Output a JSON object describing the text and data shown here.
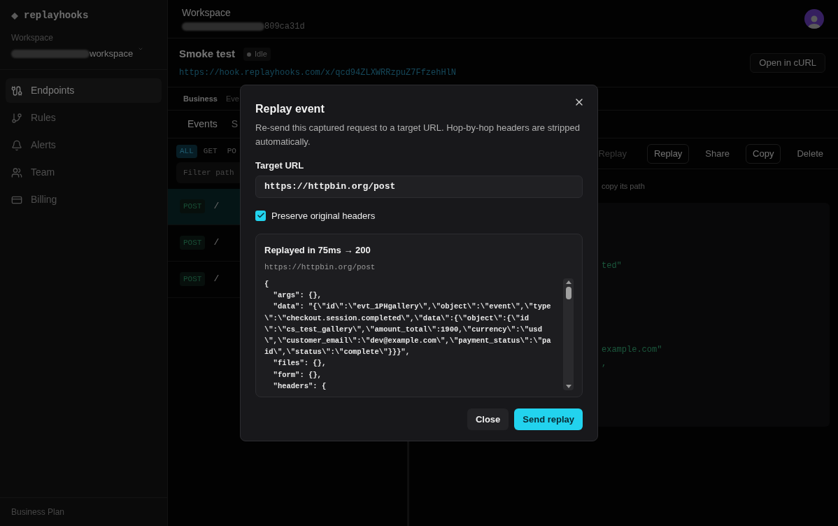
{
  "sidebar": {
    "logo": "replayhooks",
    "workspace_label": "Workspace",
    "workspace_name": "workspace",
    "nav": [
      {
        "label": "Endpoints",
        "selected": true
      },
      {
        "label": "Rules",
        "selected": false
      },
      {
        "label": "Alerts",
        "selected": false
      },
      {
        "label": "Team",
        "selected": false
      },
      {
        "label": "Billing",
        "selected": false
      }
    ],
    "plan": "Business Plan"
  },
  "header": {
    "title": "Workspace",
    "id": "809ca31d"
  },
  "endpoint": {
    "name": "Smoke test",
    "status": "Idle",
    "url": "https://hook.replayhooks.com/x/qcd94ZLXWRRzpuZ7FfzehHlN",
    "action": "Open in cURL"
  },
  "section_tabs": [
    {
      "label": "Business",
      "selected": true
    },
    {
      "label": "Eve",
      "selected": false
    }
  ],
  "view_tabs": [
    {
      "label": "Events",
      "selected": true
    },
    {
      "label": "S",
      "selected": false
    }
  ],
  "method_filters": [
    {
      "label": "ALL",
      "selected": true
    },
    {
      "label": "GET",
      "selected": false
    },
    {
      "label": "PO",
      "selected": false
    }
  ],
  "filter": {
    "placeholder": "Filter path"
  },
  "events": [
    {
      "method": "POST",
      "path": "/",
      "selected": true
    },
    {
      "method": "POST",
      "path": "/",
      "selected": false
    },
    {
      "method": "POST",
      "path": "/",
      "selected": false
    }
  ],
  "toolbar": [
    {
      "label": "Replay",
      "kind": "muted"
    },
    {
      "label": "Replay",
      "kind": "outlined"
    },
    {
      "label": "Share",
      "kind": "plain"
    },
    {
      "label": "Copy",
      "kind": "outlined"
    },
    {
      "label": "Delete",
      "kind": "plain"
    }
  ],
  "hint": "copy its path",
  "code_fragments": [
    {
      "text": "ted\""
    },
    {
      "text": "example.com\""
    },
    {
      "text": ","
    }
  ],
  "modal": {
    "title": "Replay event",
    "description": "Re-send this captured request to a target URL. Hop-by-hop headers are stripped automatically.",
    "target_label": "Target URL",
    "target_value": "https://httpbin.org/post",
    "preserve_headers": {
      "label": "Preserve original headers",
      "checked": true
    },
    "result": {
      "summary": "Replayed in 75ms → 200",
      "url": "https://httpbin.org/post",
      "body": [
        "{",
        "  \"args\": {},",
        "  \"data\": \"{\\\"id\\\":\\\"evt_1PHgallery\\\",\\\"object\\\":\\\"event\\\",\\\"type",
        "\\\":\\\"checkout.session.completed\\\",\\\"data\\\":{\\\"object\\\":{\\\"id",
        "\\\":\\\"cs_test_gallery\\\",\\\"amount_total\\\":1900,\\\"currency\\\":\\\"usd",
        "\\\",\\\"customer_email\\\":\\\"dev@example.com\\\",\\\"payment_status\\\":\\\"pa",
        "id\\\",\\\"status\\\":\\\"complete\\\"}}}\",",
        "  \"files\": {},",
        "  \"form\": {},",
        "  \"headers\": {"
      ]
    },
    "buttons": [
      {
        "label": "Close",
        "kind": "secondary"
      },
      {
        "label": "Send replay",
        "kind": "primary"
      }
    ]
  }
}
